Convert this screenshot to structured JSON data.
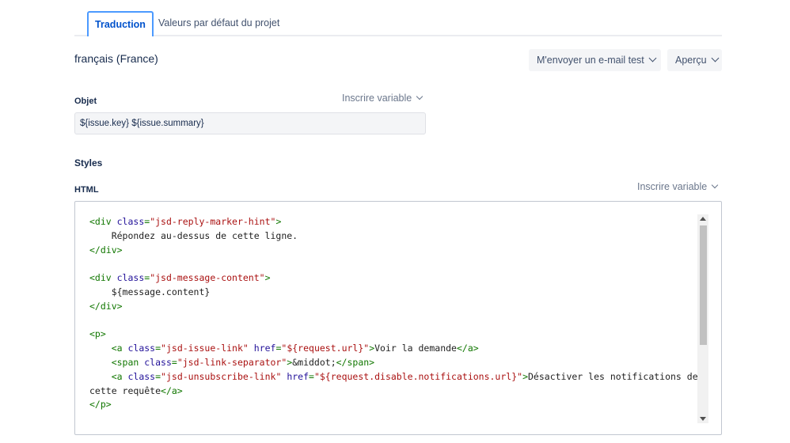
{
  "tabs": {
    "active": "Traduction",
    "inactive": "Valeurs par défaut du projet"
  },
  "language_title": "français (France)",
  "toolbar": {
    "email_test": "M'envoyer un e-mail test",
    "preview": "Aperçu"
  },
  "subject": {
    "label": "Objet",
    "insert_variable": "Inscrire variable",
    "value": "${issue.key} ${issue.summary}"
  },
  "styles_heading": "Styles",
  "html_editor": {
    "label": "HTML",
    "insert_variable": "Inscrire variable",
    "lines": [
      [
        [
          "t",
          "<div "
        ],
        [
          "a",
          "class"
        ],
        [
          "t",
          "="
        ],
        [
          "s",
          "\"jsd-reply-marker-hint\""
        ],
        [
          "t",
          ">"
        ]
      ],
      [
        [
          "p",
          "    Répondez au-dessus de cette ligne."
        ]
      ],
      [
        [
          "t",
          "</div>"
        ]
      ],
      [],
      [
        [
          "t",
          "<div "
        ],
        [
          "a",
          "class"
        ],
        [
          "t",
          "="
        ],
        [
          "s",
          "\"jsd-message-content\""
        ],
        [
          "t",
          ">"
        ]
      ],
      [
        [
          "p",
          "    ${message.content}"
        ]
      ],
      [
        [
          "t",
          "</div>"
        ]
      ],
      [],
      [
        [
          "t",
          "<p>"
        ]
      ],
      [
        [
          "p",
          "    "
        ],
        [
          "t",
          "<a "
        ],
        [
          "a",
          "class"
        ],
        [
          "t",
          "="
        ],
        [
          "s",
          "\"jsd-issue-link\""
        ],
        [
          "p",
          " "
        ],
        [
          "a",
          "href"
        ],
        [
          "t",
          "="
        ],
        [
          "s",
          "\"${request.url}\""
        ],
        [
          "t",
          ">"
        ],
        [
          "p",
          "Voir la demande"
        ],
        [
          "t",
          "</a>"
        ]
      ],
      [
        [
          "p",
          "    "
        ],
        [
          "t",
          "<span "
        ],
        [
          "a",
          "class"
        ],
        [
          "t",
          "="
        ],
        [
          "s",
          "\"jsd-link-separator\""
        ],
        [
          "t",
          ">"
        ],
        [
          "p",
          "&middot;"
        ],
        [
          "t",
          "</span>"
        ]
      ],
      [
        [
          "p",
          "    "
        ],
        [
          "t",
          "<a "
        ],
        [
          "a",
          "class"
        ],
        [
          "t",
          "="
        ],
        [
          "s",
          "\"jsd-unsubscribe-link\""
        ],
        [
          "p",
          " "
        ],
        [
          "a",
          "href"
        ],
        [
          "t",
          "="
        ],
        [
          "s",
          "\"${request.disable.notifications.url}\""
        ],
        [
          "t",
          ">"
        ],
        [
          "p",
          "Désactiver les notifications de"
        ]
      ],
      [
        [
          "p",
          "cette requête"
        ],
        [
          "t",
          "</a>"
        ]
      ],
      [
        [
          "t",
          "</p>"
        ]
      ]
    ]
  }
}
